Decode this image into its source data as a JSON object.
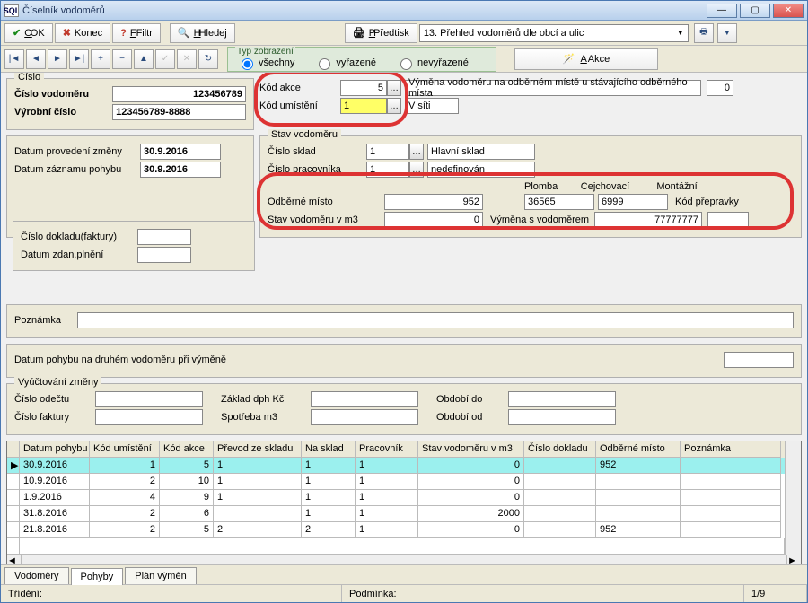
{
  "window": {
    "title": "Číselník vodoměrů",
    "icon_text": "SQL"
  },
  "toolbar": {
    "ok": "OK",
    "konec": "Konec",
    "filtr": "Filtr",
    "hledej": "Hledej",
    "predtisk": "Předtisk",
    "predtisk_combo": "13. Přehled vodoměrů dle obcí a ulic"
  },
  "typ": {
    "legend": "Typ zobrazení",
    "vsechny": "všechny",
    "vyrazene": "vyřazené",
    "nevyrazene": "nevyřazené"
  },
  "akce_btn": "Akce",
  "cislo": {
    "legend": "Číslo",
    "cislo_vodomeru_lbl": "Číslo vodoměru",
    "cislo_vodomeru_val": "123456789",
    "vyrobni_cislo_lbl": "Výrobní číslo",
    "vyrobni_cislo_val": "123456789-8888"
  },
  "akce": {
    "kod_akce_lbl": "Kód akce",
    "kod_akce_val": "5",
    "kod_akce_text": "Výměna vodoměru na odběrném místě u stávajícího odběrného místa",
    "kod_akce_right": "0",
    "kod_umisteni_lbl": "Kód umístění",
    "kod_umisteni_val": "1",
    "kod_umisteni_text": "V síti"
  },
  "dates": {
    "provedeni_lbl": "Datum provedení změny",
    "provedeni_val": "30.9.2016",
    "zaznam_lbl": "Datum záznamu pohybu",
    "zaznam_val": "30.9.2016"
  },
  "stav": {
    "legend": "Stav vodoměru",
    "sklad_lbl": "Číslo sklad",
    "sklad_val": "1",
    "sklad_text": "Hlavní sklad",
    "prac_lbl": "Číslo pracovníka",
    "prac_val": "1",
    "prac_text": "nedefinován",
    "cejch_lbl": "Cejchovací",
    "mont_lbl": "Montážní",
    "odberne_lbl": "Odběrné místo",
    "odberne_val": "952",
    "plomba_lbl": "Plomba",
    "plomba_cejch": "36565",
    "plomba_mont": "6999",
    "kod_prepravky_lbl": "Kód přepravky",
    "stav_m3_lbl": "Stav vodoměru v m3",
    "stav_m3_val": "0",
    "vymena_lbl": "Výměna s vodoměrem",
    "vymena_val": "77777777"
  },
  "doklad": {
    "cislo_dokladu_lbl": "Číslo dokladu(faktury)",
    "datum_zdan_lbl": "Datum zdan.plnění"
  },
  "poznamka_lbl": "Poznámka",
  "pohyb2_lbl": "Datum pohybu na druhém vodoměru při výměně",
  "vyuct": {
    "legend": "Vyúčtování změny",
    "odectu_lbl": "Číslo odečtu",
    "zaklad_lbl": "Základ dph Kč",
    "obdobi_do_lbl": "Období do",
    "faktury_lbl": "Číslo faktury",
    "spotreba_lbl": "Spotřeba m3",
    "obdobi_od_lbl": "Období od"
  },
  "grid": {
    "cols": [
      "Datum pohybu",
      "Kód umístění",
      "Kód akce",
      "Převod ze skladu",
      "Na sklad",
      "Pracovník",
      "Stav vodoměru v m3",
      "Číslo dokladu",
      "Odběrné místo",
      "Poznámka"
    ],
    "rows": [
      {
        "sel": true,
        "c": [
          "30.9.2016",
          "1",
          "5",
          "1",
          "1",
          "1",
          "0",
          "",
          "952",
          ""
        ]
      },
      {
        "c": [
          "10.9.2016",
          "2",
          "10",
          "1",
          "1",
          "1",
          "0",
          "",
          "",
          ""
        ]
      },
      {
        "c": [
          "1.9.2016",
          "4",
          "9",
          "1",
          "1",
          "1",
          "0",
          "",
          "",
          ""
        ]
      },
      {
        "c": [
          "31.8.2016",
          "2",
          "6",
          "",
          "1",
          "1",
          "2000",
          "",
          "",
          ""
        ]
      },
      {
        "c": [
          "21.8.2016",
          "2",
          "5",
          "2",
          "2",
          "1",
          "0",
          "",
          "952",
          ""
        ]
      }
    ]
  },
  "tabs": {
    "vodomery": "Vodoměry",
    "pohyby": "Pohyby",
    "plan": "Plán výměn"
  },
  "status": {
    "trideni": "Třídění:",
    "podminka": "Podmínka:",
    "pager": "1/9"
  }
}
